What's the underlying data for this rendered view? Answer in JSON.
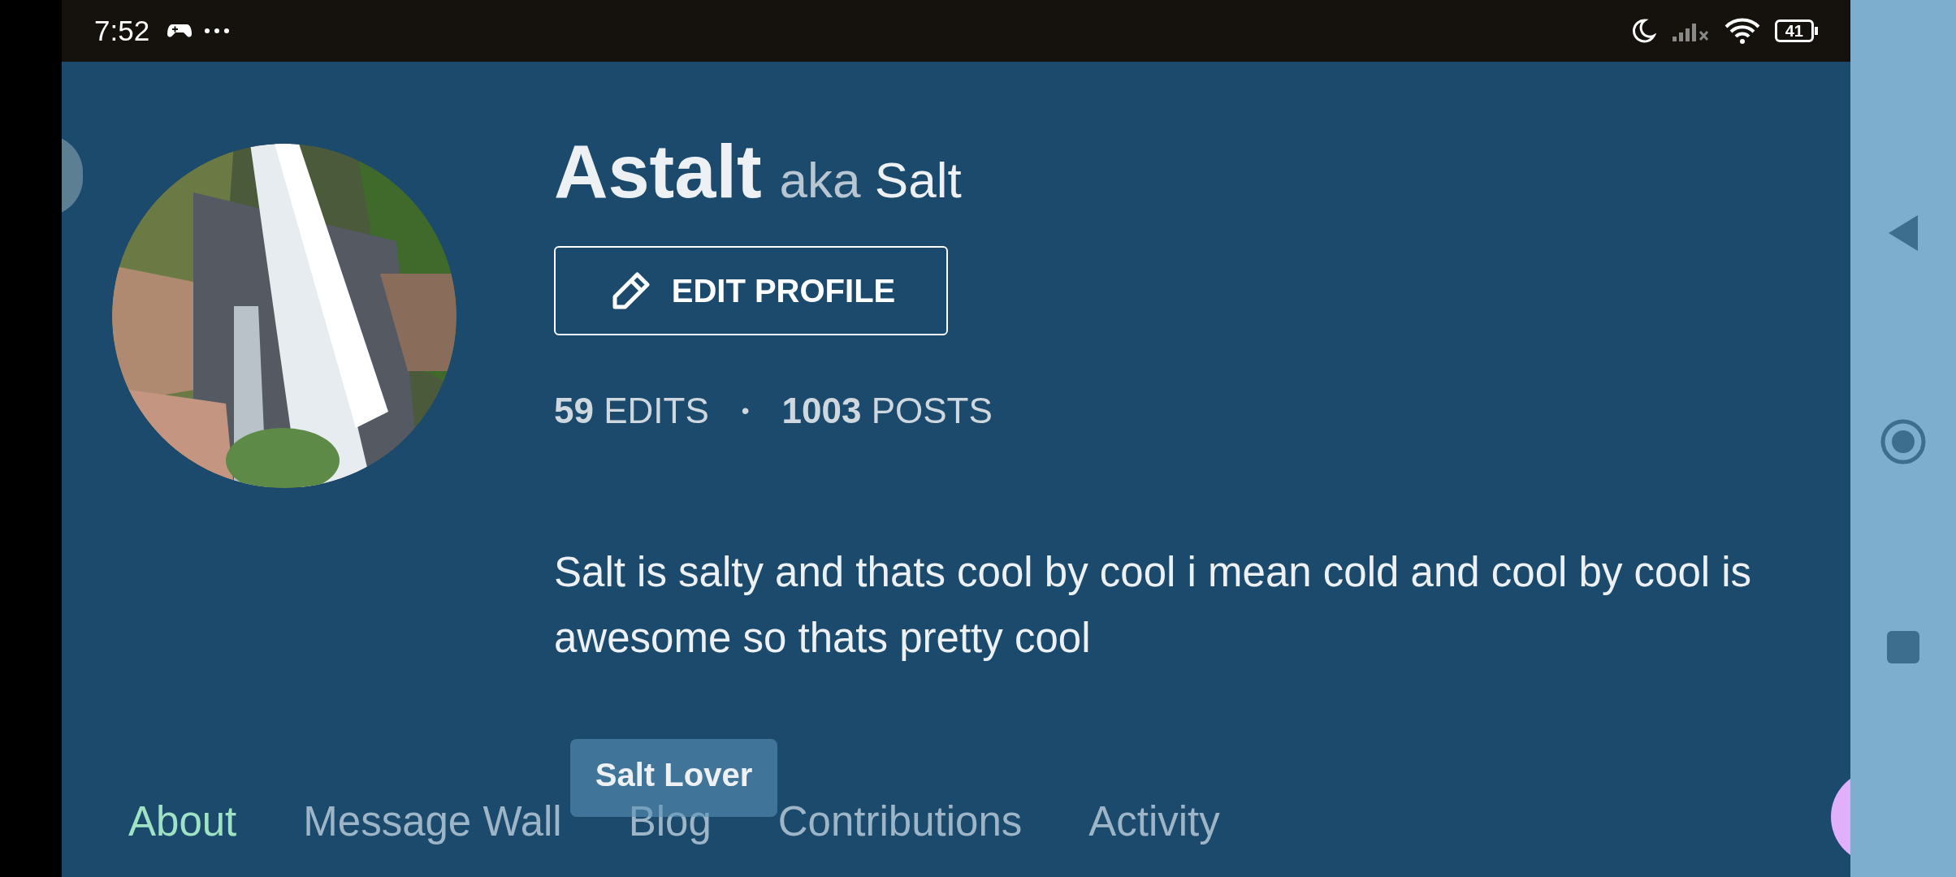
{
  "status_bar": {
    "time": "7:52",
    "battery": "41"
  },
  "profile": {
    "name": "Astalt",
    "aka": "aka",
    "nickname": "Salt",
    "edit_button": "EDIT PROFILE",
    "separator": "•",
    "stats": [
      {
        "count": "59",
        "label": "EDITS"
      },
      {
        "count": "1003",
        "label": "POSTS"
      }
    ],
    "bio": "Salt is salty and thats cool by cool i mean cold and cool by cool is awesome so thats pretty cool"
  },
  "tabs": [
    {
      "label": "About",
      "selected": true
    },
    {
      "label": "Message Wall",
      "selected": false
    },
    {
      "label": "Blog",
      "selected": false
    },
    {
      "label": "Contributions",
      "selected": false
    },
    {
      "label": "Activity",
      "selected": false
    }
  ],
  "tooltip": "Salt Lover"
}
